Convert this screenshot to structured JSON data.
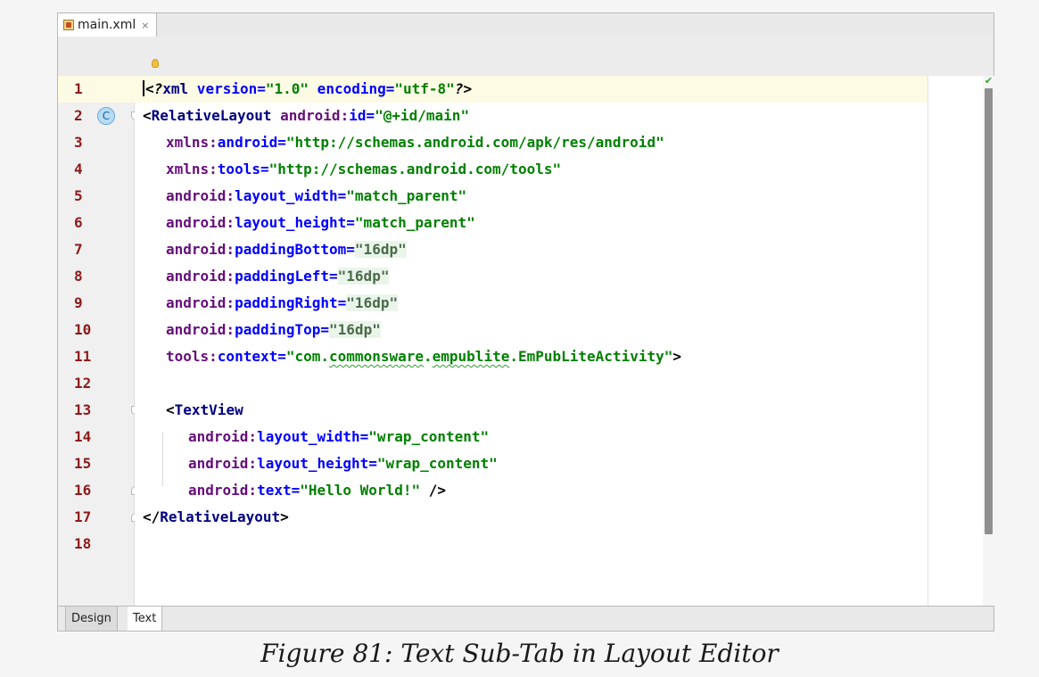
{
  "file_tab": {
    "label": "main.xml",
    "close": "×",
    "icon": "xml-file-icon"
  },
  "line_numbers": [
    "1",
    "2",
    "3",
    "4",
    "5",
    "6",
    "7",
    "8",
    "9",
    "10",
    "11",
    "12",
    "13",
    "14",
    "15",
    "16",
    "17",
    "18"
  ],
  "code": {
    "l1_open": "<?",
    "l1_xml": "xml",
    "l1_version_attr": " version=",
    "l1_version_val": "\"1.0\"",
    "l1_encoding_attr": " encoding=",
    "l1_encoding_val": "\"utf-8\"",
    "l1_close": "?>",
    "l2_open": "<",
    "l2_tag": "RelativeLayout",
    "l2_ns": " android:",
    "l2_attr": "id=",
    "l2_val": "\"@+id/main\"",
    "l3_ns": "xmlns:",
    "l3_attr": "android=",
    "l3_val": "\"http://schemas.android.com/apk/res/android\"",
    "l4_ns": "xmlns:",
    "l4_attr": "tools=",
    "l4_val": "\"http://schemas.android.com/tools\"",
    "l5_ns": "android:",
    "l5_attr": "layout_width=",
    "l5_val": "\"match_parent\"",
    "l6_ns": "android:",
    "l6_attr": "layout_height=",
    "l6_val": "\"match_parent\"",
    "l7_ns": "android:",
    "l7_attr": "paddingBottom=",
    "l7_val": "\"16dp\"",
    "l8_ns": "android:",
    "l8_attr": "paddingLeft=",
    "l8_val": "\"16dp\"",
    "l9_ns": "android:",
    "l9_attr": "paddingRight=",
    "l9_val": "\"16dp\"",
    "l10_ns": "android:",
    "l10_attr": "paddingTop=",
    "l10_val": "\"16dp\"",
    "l11_ns": "tools:",
    "l11_attr": "context=",
    "l11_val_a": "\"com.",
    "l11_val_b": "commonsware",
    "l11_val_c": ".",
    "l11_val_d": "empublite",
    "l11_val_e": ".EmPubLiteActivity\"",
    "l11_close": ">",
    "l13_open": "<",
    "l13_tag": "TextView",
    "l14_ns": "android:",
    "l14_attr": "layout_width=",
    "l14_val": "\"wrap_content\"",
    "l15_ns": "android:",
    "l15_attr": "layout_height=",
    "l15_val": "\"wrap_content\"",
    "l16_ns": "android:",
    "l16_attr": "text=",
    "l16_val": "\"Hello World!\"",
    "l16_close": " />",
    "l17_open": "</",
    "l17_tag": "RelativeLayout",
    "l17_close": ">"
  },
  "gutter_badge": "C",
  "bottom_tabs": {
    "design": "Design",
    "text": "Text",
    "active": "Text"
  },
  "caption": "Figure 81: Text Sub-Tab in Layout Editor",
  "colors": {
    "line_number": "#8d1a1a",
    "tag": "#000080",
    "namespace": "#660e7a",
    "attribute": "#0000ff",
    "value": "#008000",
    "current_line": "#fdfbe4"
  }
}
